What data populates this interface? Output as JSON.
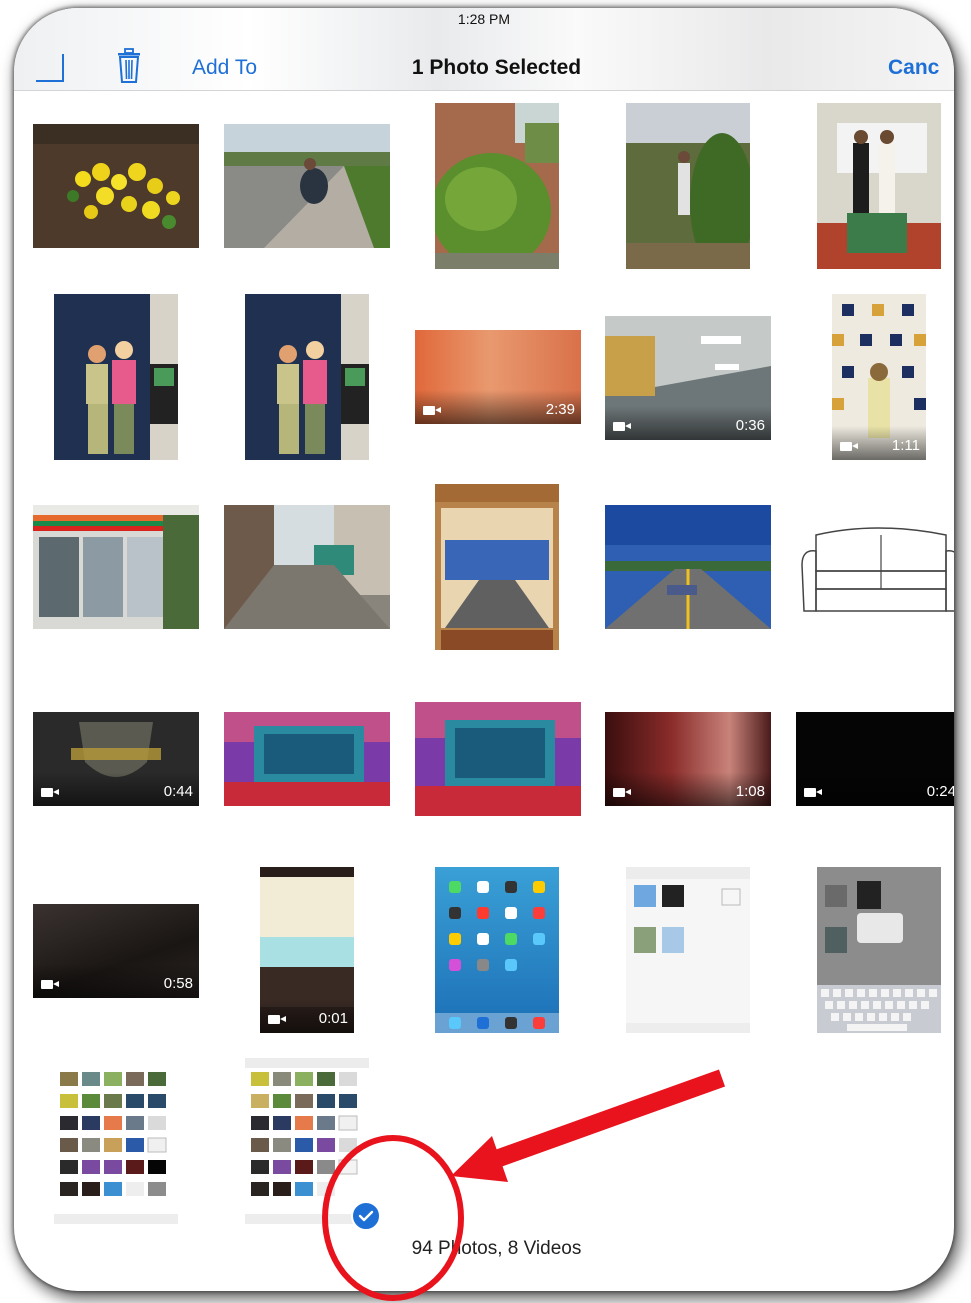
{
  "status_bar": {
    "time": "1:28 PM"
  },
  "toolbar": {
    "add_to_label": "Add To",
    "title": "1 Photo Selected",
    "cancel_label": "Canc"
  },
  "grid": {
    "items": [
      {
        "kind": "photo",
        "desc": "flowers"
      },
      {
        "kind": "photo",
        "desc": "sidewalk"
      },
      {
        "kind": "photo",
        "desc": "bush"
      },
      {
        "kind": "photo",
        "desc": "garden"
      },
      {
        "kind": "photo",
        "desc": "classroom"
      },
      {
        "kind": "photo",
        "desc": "two-women-1"
      },
      {
        "kind": "photo",
        "desc": "two-women-2"
      },
      {
        "kind": "video",
        "duration": "2:39"
      },
      {
        "kind": "video",
        "duration": "0:36"
      },
      {
        "kind": "video",
        "duration": "1:11"
      },
      {
        "kind": "photo",
        "desc": "store"
      },
      {
        "kind": "photo",
        "desc": "alley"
      },
      {
        "kind": "photo",
        "desc": "app-screenshot"
      },
      {
        "kind": "photo",
        "desc": "road"
      },
      {
        "kind": "photo",
        "desc": "sofa-sketch"
      },
      {
        "kind": "video",
        "duration": "0:44"
      },
      {
        "kind": "photo",
        "desc": "building-1"
      },
      {
        "kind": "photo",
        "desc": "building-2"
      },
      {
        "kind": "video",
        "duration": "1:08"
      },
      {
        "kind": "video",
        "duration": "0:24"
      },
      {
        "kind": "video",
        "duration": "0:58"
      },
      {
        "kind": "video",
        "duration": "0:01"
      },
      {
        "kind": "photo",
        "desc": "ipad-homescreen"
      },
      {
        "kind": "photo",
        "desc": "ipad-screenshot-album"
      },
      {
        "kind": "photo",
        "desc": "ipad-screenshot-keyboard"
      },
      {
        "kind": "photo",
        "desc": "ipad-screenshot-grid-1"
      },
      {
        "kind": "photo",
        "desc": "ipad-screenshot-grid-2",
        "selected": true
      }
    ]
  },
  "footer": {
    "summary": "94 Photos, 8 Videos"
  },
  "colors": {
    "accent": "#1e6fd6",
    "annotation": "#e8131c"
  }
}
